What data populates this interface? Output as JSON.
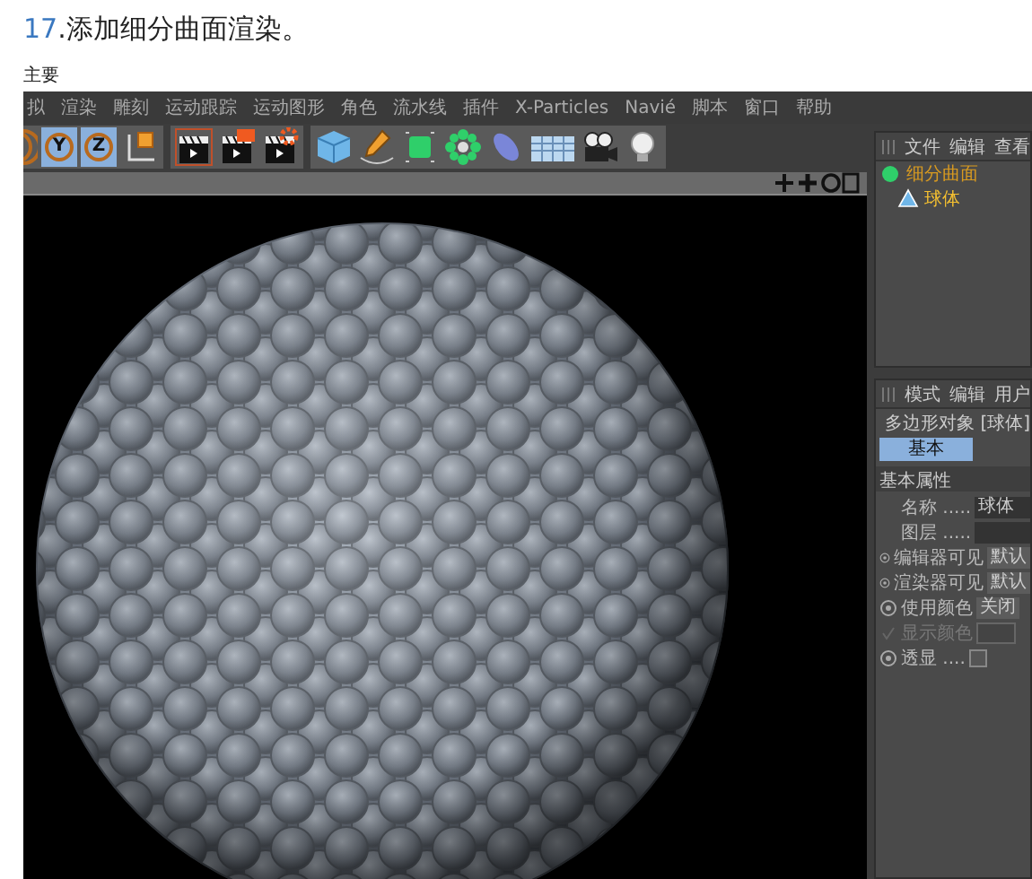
{
  "heading": {
    "number": "17",
    "text": ".添加细分曲面渲染。"
  },
  "caption": "主要",
  "menu": [
    "拟",
    "渲染",
    "雕刻",
    "运动跟踪",
    "运动图形",
    "角色",
    "流水线",
    "插件",
    "X-Particles",
    "Navié",
    "脚本",
    "窗口",
    "帮助"
  ],
  "axis_buttons": [
    {
      "label": "Y",
      "on": true
    },
    {
      "label": "Z",
      "on": true
    }
  ],
  "object_manager": {
    "menu": [
      "文件",
      "编辑",
      "查看"
    ],
    "objects": [
      {
        "name": "细分曲面",
        "selected": true,
        "children": [
          {
            "name": "球体",
            "selected": true
          }
        ]
      }
    ]
  },
  "attributes": {
    "menu": [
      "模式",
      "编辑",
      "用户"
    ],
    "title": "多边形对象 [球体]",
    "tabs": [
      {
        "label": "基本",
        "selected": true
      }
    ],
    "section": "基本属性",
    "rows": [
      {
        "kind": "text",
        "label": "名称 .....",
        "value": "球体"
      },
      {
        "kind": "text",
        "label": "图层 ....."
      },
      {
        "kind": "dropdown",
        "label": "编辑器可见",
        "value": "默认",
        "disabled": false
      },
      {
        "kind": "dropdown",
        "label": "渲染器可见",
        "value": "默认",
        "disabled": false
      },
      {
        "kind": "dropdown",
        "label": "使用颜色",
        "value": "关闭",
        "disabled": false
      },
      {
        "kind": "color",
        "label": "显示颜色",
        "disabled": true
      },
      {
        "kind": "checkbox",
        "label": "透显 ....",
        "checked": false
      }
    ]
  }
}
